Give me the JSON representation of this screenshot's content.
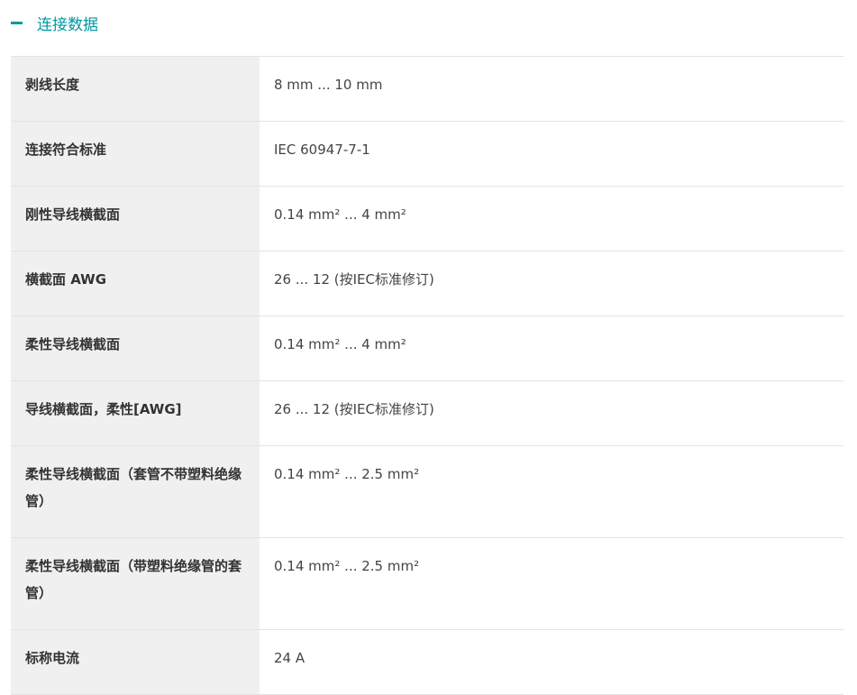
{
  "section": {
    "title": "连接数据",
    "toggle_icon": "minus-icon"
  },
  "rows": [
    {
      "label": "剥线长度",
      "value": "8 mm ... 10 mm"
    },
    {
      "label": "连接符合标准",
      "value": "IEC 60947-7-1"
    },
    {
      "label": "刚性导线横截面",
      "value": "0.14 mm² ... 4 mm²"
    },
    {
      "label": "横截面 AWG",
      "value": "26 ... 12 (按IEC标准修订)"
    },
    {
      "label": "柔性导线横截面",
      "value": "0.14 mm² ... 4 mm²"
    },
    {
      "label": "导线横截面，柔性[AWG]",
      "value": "26 ... 12 (按IEC标准修订)"
    },
    {
      "label": "柔性导线横截面（套管不带塑料绝缘管）",
      "value": "0.14 mm² ... 2.5 mm²"
    },
    {
      "label": "柔性导线横截面（带塑料绝缘管的套管）",
      "value": "0.14 mm² ... 2.5 mm²"
    },
    {
      "label": "标称电流",
      "value": "24 A"
    }
  ],
  "colors": {
    "accent": "#0098a1",
    "label_bg": "#f0f0f0",
    "divider": "#e3e3e3"
  }
}
